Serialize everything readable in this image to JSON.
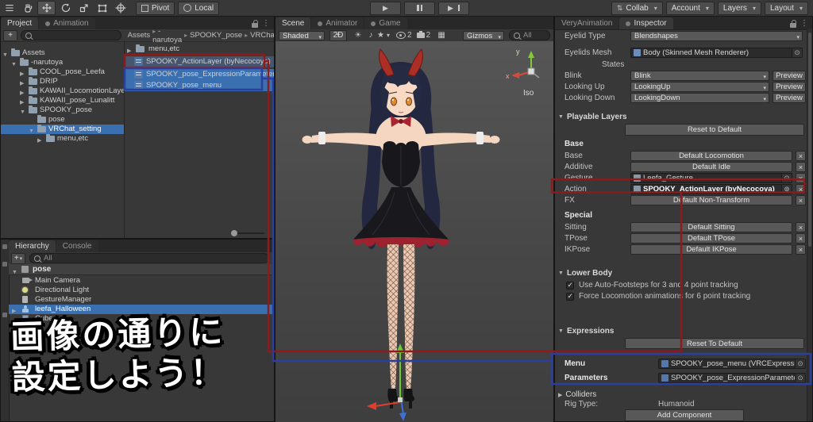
{
  "topbar": {
    "pivot": "Pivot",
    "local": "Local",
    "collab": "Collab",
    "account": "Account",
    "layers": "Layers",
    "layout": "Layout"
  },
  "project": {
    "tabs": {
      "project": "Project",
      "animation": "Animation"
    },
    "breadcrumb": [
      "Assets",
      "-narutoya",
      "SPOOKY_pose",
      "VRChat..."
    ],
    "tree": [
      {
        "label": "Assets"
      },
      {
        "label": "-narutoya"
      },
      {
        "label": "COOL_pose_Leefa"
      },
      {
        "label": "DRIP"
      },
      {
        "label": "KAWAII_LocomotionLayer"
      },
      {
        "label": "KAWAII_pose_Lunalitt"
      },
      {
        "label": "SPOOKY_pose"
      },
      {
        "label": "pose"
      },
      {
        "label": "VRChat_setting"
      },
      {
        "label": "menu,etc"
      }
    ],
    "files": [
      {
        "label": "menu,etc"
      },
      {
        "label": "SPOOKY_ActionLayer (byNecocoya)"
      },
      {
        "label": "SPOOKY_pose_ExpressionParameters"
      },
      {
        "label": "SPOOKY_pose_menu"
      }
    ]
  },
  "hierarchy": {
    "tabs": {
      "hierarchy": "Hierarchy",
      "console": "Console"
    },
    "search_filter": "All",
    "scene_name": "pose",
    "items": [
      "Main Camera",
      "Directional Light",
      "GestureManager",
      "leefa_Halloween",
      "Cube"
    ]
  },
  "scene": {
    "tabs": {
      "scene": "Scene",
      "animator": "Animator",
      "game": "Game"
    },
    "toolbar": {
      "shading": "Shaded",
      "mode_2d": "2D",
      "gizmos": "Gizmos",
      "search": "All",
      "visibility_count": "2",
      "effects_count": "2"
    },
    "axis": {
      "x_label": "x",
      "y_label": "y",
      "projection": "Iso"
    },
    "overlay_lines": [
      "画像の通りに",
      "設定しよう！"
    ]
  },
  "inspector": {
    "tabs": {
      "very_animation": "VeryAnimation",
      "inspector": "Inspector"
    },
    "eyelid_type": {
      "label": "Eyelid Type",
      "value": "Blendshapes"
    },
    "eyelids_mesh": {
      "label": "Eyelids Mesh",
      "value": "Body (Skinned Mesh Renderer)"
    },
    "states_label": "States",
    "blink": {
      "label": "Blink",
      "value": "Blink",
      "button": "Preview"
    },
    "looking_up": {
      "label": "Looking Up",
      "value": "LookingUp",
      "button": "Preview"
    },
    "looking_down": {
      "label": "Looking Down",
      "value": "LookingDown",
      "button": "Preview"
    },
    "playable_layers": {
      "title": "Playable Layers",
      "reset": "Reset to Default",
      "base_header": "Base",
      "rows": [
        {
          "label": "Base",
          "value": "Default Locomotion"
        },
        {
          "label": "Additive",
          "value": "Default Idle"
        },
        {
          "label": "Gesture",
          "value": "Leefa_Gesture"
        },
        {
          "label": "Action",
          "value": "SPOOKY_ActionLayer (byNecocoya)"
        },
        {
          "label": "FX",
          "value": "Default Non-Transform"
        }
      ],
      "special_header": "Special",
      "special_rows": [
        {
          "label": "Sitting",
          "value": "Default Sitting"
        },
        {
          "label": "TPose",
          "value": "Default TPose"
        },
        {
          "label": "IKPose",
          "value": "Default IKPose"
        }
      ]
    },
    "lower_body": {
      "title": "Lower Body",
      "checkboxes": [
        "Use Auto-Footsteps for 3 and 4 point tracking",
        "Force Locomotion animations for 6 point tracking"
      ]
    },
    "expressions": {
      "title": "Expressions",
      "reset": "Reset To Default",
      "menu": {
        "label": "Menu",
        "value": "SPOOKY_pose_menu (VRCExpression"
      },
      "parameters": {
        "label": "Parameters",
        "value": "SPOOKY_pose_ExpressionParameters"
      }
    },
    "colliders_label": "Colliders",
    "rig_type": {
      "label": "Rig Type:",
      "value": "Humanoid"
    },
    "add_component": "Add Component"
  },
  "icons": {
    "search": "⌕ (css circle+handle)",
    "lock": "padlock (css)",
    "folder": "folder (css)",
    "dropdown_arrow": "▾",
    "foldout_open": "▼",
    "foldout_closed": "▶",
    "object_picker": "⊙",
    "remove": "×",
    "check": "✓",
    "play": "▶",
    "pause": "double-bar (css)",
    "step": "play+bar (css)",
    "kebab_menu": "⋮",
    "breadcrumb_separator": "▸"
  }
}
